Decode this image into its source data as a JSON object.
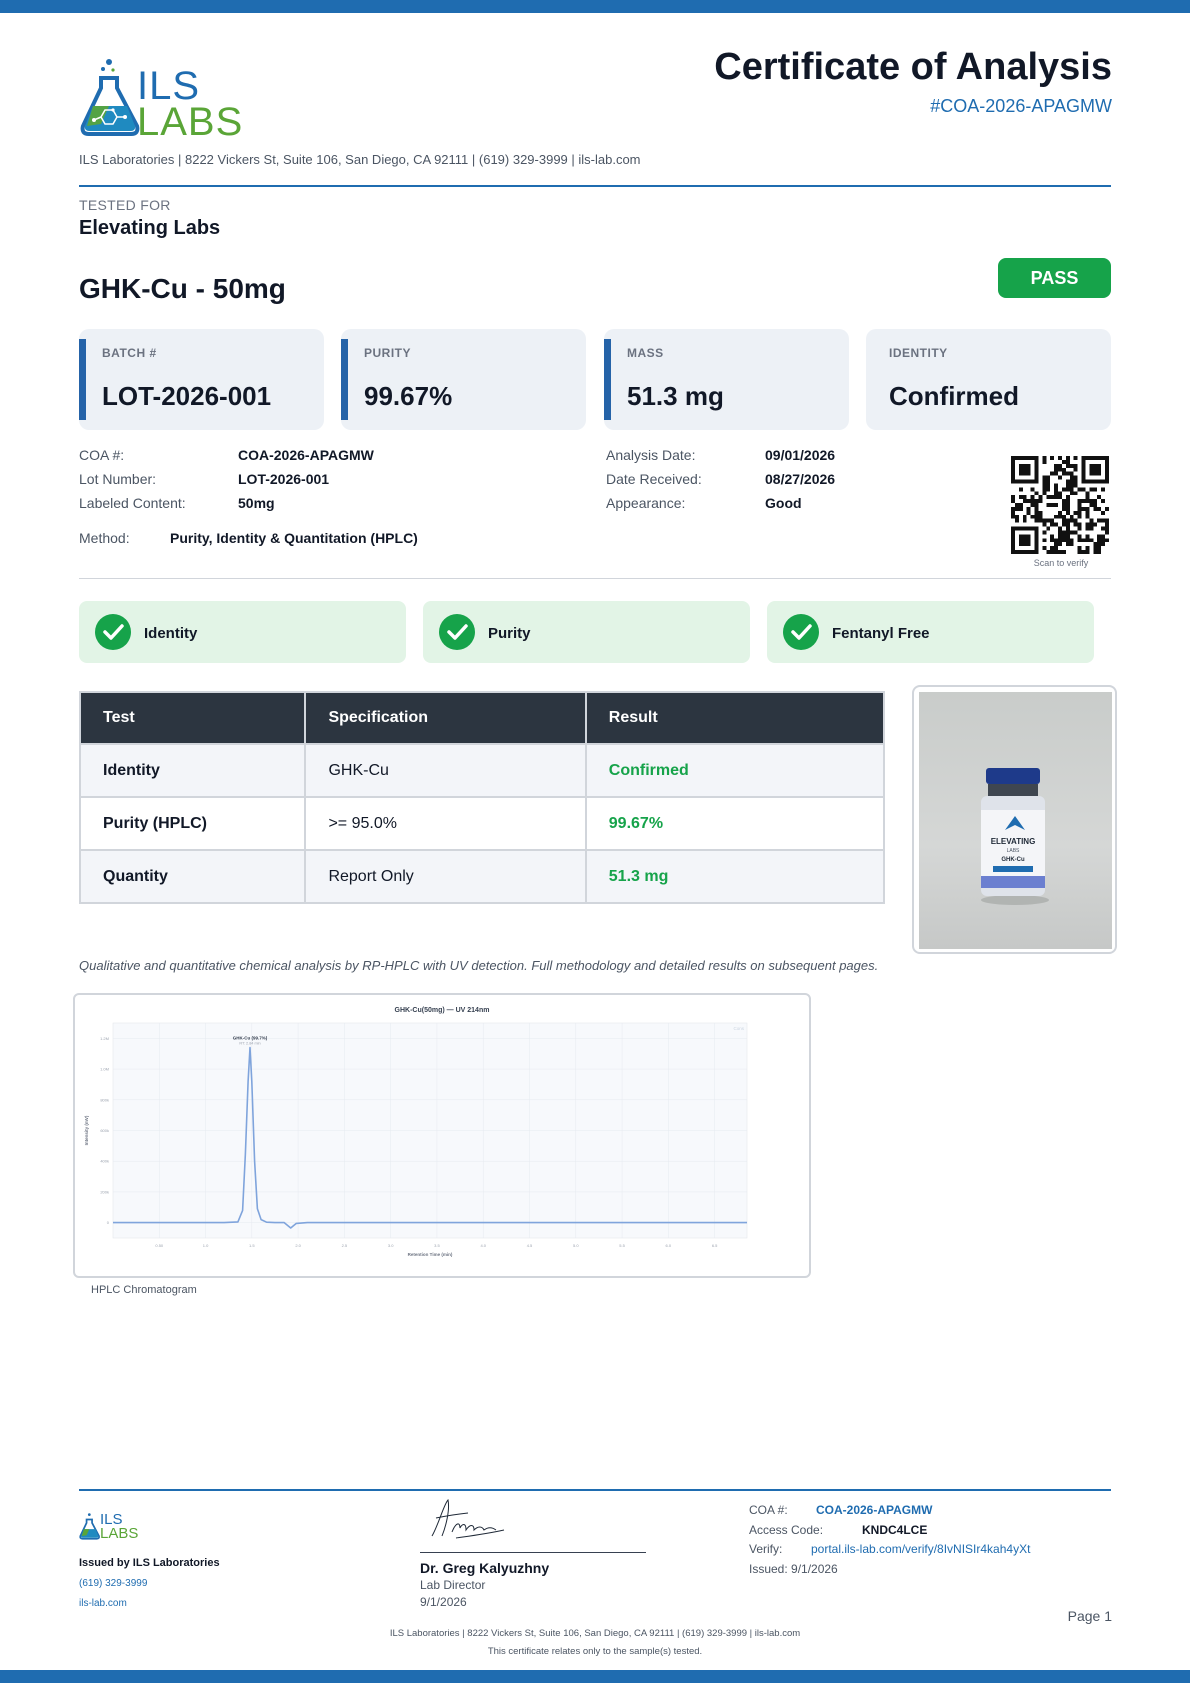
{
  "header": {
    "logo_top": "ILS",
    "logo_bottom": "LABS",
    "title": "Certificate of Analysis",
    "coa_id": "#COA-2026-APAGMW",
    "address_line": "ILS Laboratories  |  8222 Vickers St, Suite 106, San Diego, CA 92111  |  (619) 329-3999  |  ils-lab.com"
  },
  "client": {
    "label": "TESTED FOR",
    "name": "Elevating Labs"
  },
  "product": {
    "name": "GHK-Cu - 50mg",
    "status": "PASS"
  },
  "cards": [
    {
      "label": "BATCH #",
      "value": "LOT-2026-001"
    },
    {
      "label": "PURITY",
      "value": "99.67%"
    },
    {
      "label": "MASS",
      "value": "51.3 mg"
    },
    {
      "label": "IDENTITY",
      "value": "Confirmed"
    }
  ],
  "meta_left": [
    {
      "label": "COA #:",
      "value": "COA-2026-APAGMW"
    },
    {
      "label": "Lot Number:",
      "value": "LOT-2026-001"
    },
    {
      "label": "Labeled Content:",
      "value": "50mg"
    }
  ],
  "meta_right": [
    {
      "label": "Analysis Date:",
      "value": "09/01/2026"
    },
    {
      "label": "Date Received:",
      "value": "08/27/2026"
    },
    {
      "label": "Appearance:",
      "value": "Good"
    }
  ],
  "method": {
    "label": "Method:",
    "value": "Purity, Identity & Quantitation (HPLC)"
  },
  "qr": {
    "caption": "Scan to verify"
  },
  "checks": [
    "Identity",
    "Purity",
    "Fentanyl Free"
  ],
  "results_table": {
    "headers": [
      "Test",
      "Specification",
      "Result"
    ],
    "rows": [
      {
        "test": "Identity",
        "spec": "GHK-Cu",
        "result": "Confirmed"
      },
      {
        "test": "Purity (HPLC)",
        "spec": ">= 95.0%",
        "result": "99.67%"
      },
      {
        "test": "Quantity",
        "spec": "Report Only",
        "result": "51.3 mg"
      }
    ]
  },
  "vial": {
    "brand": "ELEVATING",
    "sub": "LABS",
    "product": "GHK-Cu"
  },
  "note": "Qualitative and quantitative chemical analysis by RP-HPLC with UV detection. Full methodology and detailed results on subsequent pages.",
  "chromatogram": {
    "caption": "HPLC Chromatogram",
    "legend": "Cons",
    "peak_label": "GHK-Cu (99.7%)",
    "peak_sublabel": "RT: 2.84 min"
  },
  "chart_data": {
    "type": "line",
    "title": "GHK-Cu(50mg) — UV 214nm",
    "xlabel": "Retention Time (min)",
    "ylabel": "Intensity (mV)",
    "xlim": [
      0.0,
      6.85
    ],
    "ylim": [
      -100000,
      1300000
    ],
    "x_ticks": [
      "0.50",
      "1.0",
      "1.5",
      "2.0",
      "2.5",
      "3.0",
      "3.5",
      "4.0",
      "4.5",
      "5.0",
      "5.5",
      "6.0",
      "6.5"
    ],
    "y_ticks": [
      "0",
      "200k",
      "400k",
      "600k",
      "800k",
      "1.0M",
      "1.2M"
    ],
    "series": [
      {
        "x": [
          0.0,
          1.2,
          1.35,
          1.4,
          1.43,
          1.46,
          1.48,
          1.5,
          1.53,
          1.56,
          1.6,
          1.66,
          1.75,
          1.85,
          1.92,
          1.98,
          2.1,
          3.0,
          4.0,
          5.0,
          5.8,
          6.0,
          6.85
        ],
        "y": [
          0,
          0,
          5000,
          80000,
          450000,
          920000,
          1140000,
          920000,
          400000,
          90000,
          20000,
          3000,
          0,
          0,
          -35000,
          -5000,
          0,
          0,
          0,
          0,
          0,
          0,
          0
        ]
      }
    ],
    "grid": true
  },
  "footer": {
    "issued_by": "Issued by ILS Laboratories",
    "phone": "(619) 329-3999",
    "web": "ils-lab.com",
    "signer_name": "Dr. Greg Kalyuzhny",
    "signer_role": "Lab Director",
    "signer_date": "9/1/2026",
    "coa_label": "COA #:",
    "coa_value": "COA-2026-APAGMW",
    "access_label": "Access Code:",
    "access_value": "KNDC4LCE",
    "verify_label": "Verify:",
    "verify_value": "portal.ils-lab.com/verify/8IvNISIr4kah4yXt",
    "issued_date": "Issued: 9/1/2026",
    "page": "Page 1",
    "bottom_line": "ILS Laboratories  |  8222 Vickers St, Suite 106, San Diego, CA 92111  |  (619) 329-3999  |  ils-lab.com",
    "disclaimer": "This certificate relates only to the sample(s) tested."
  },
  "colors": {
    "brand_blue": "#1f6cb0",
    "pass_green": "#16a34a",
    "logo_green": "#5aa537",
    "header_dark": "#2c3540"
  }
}
